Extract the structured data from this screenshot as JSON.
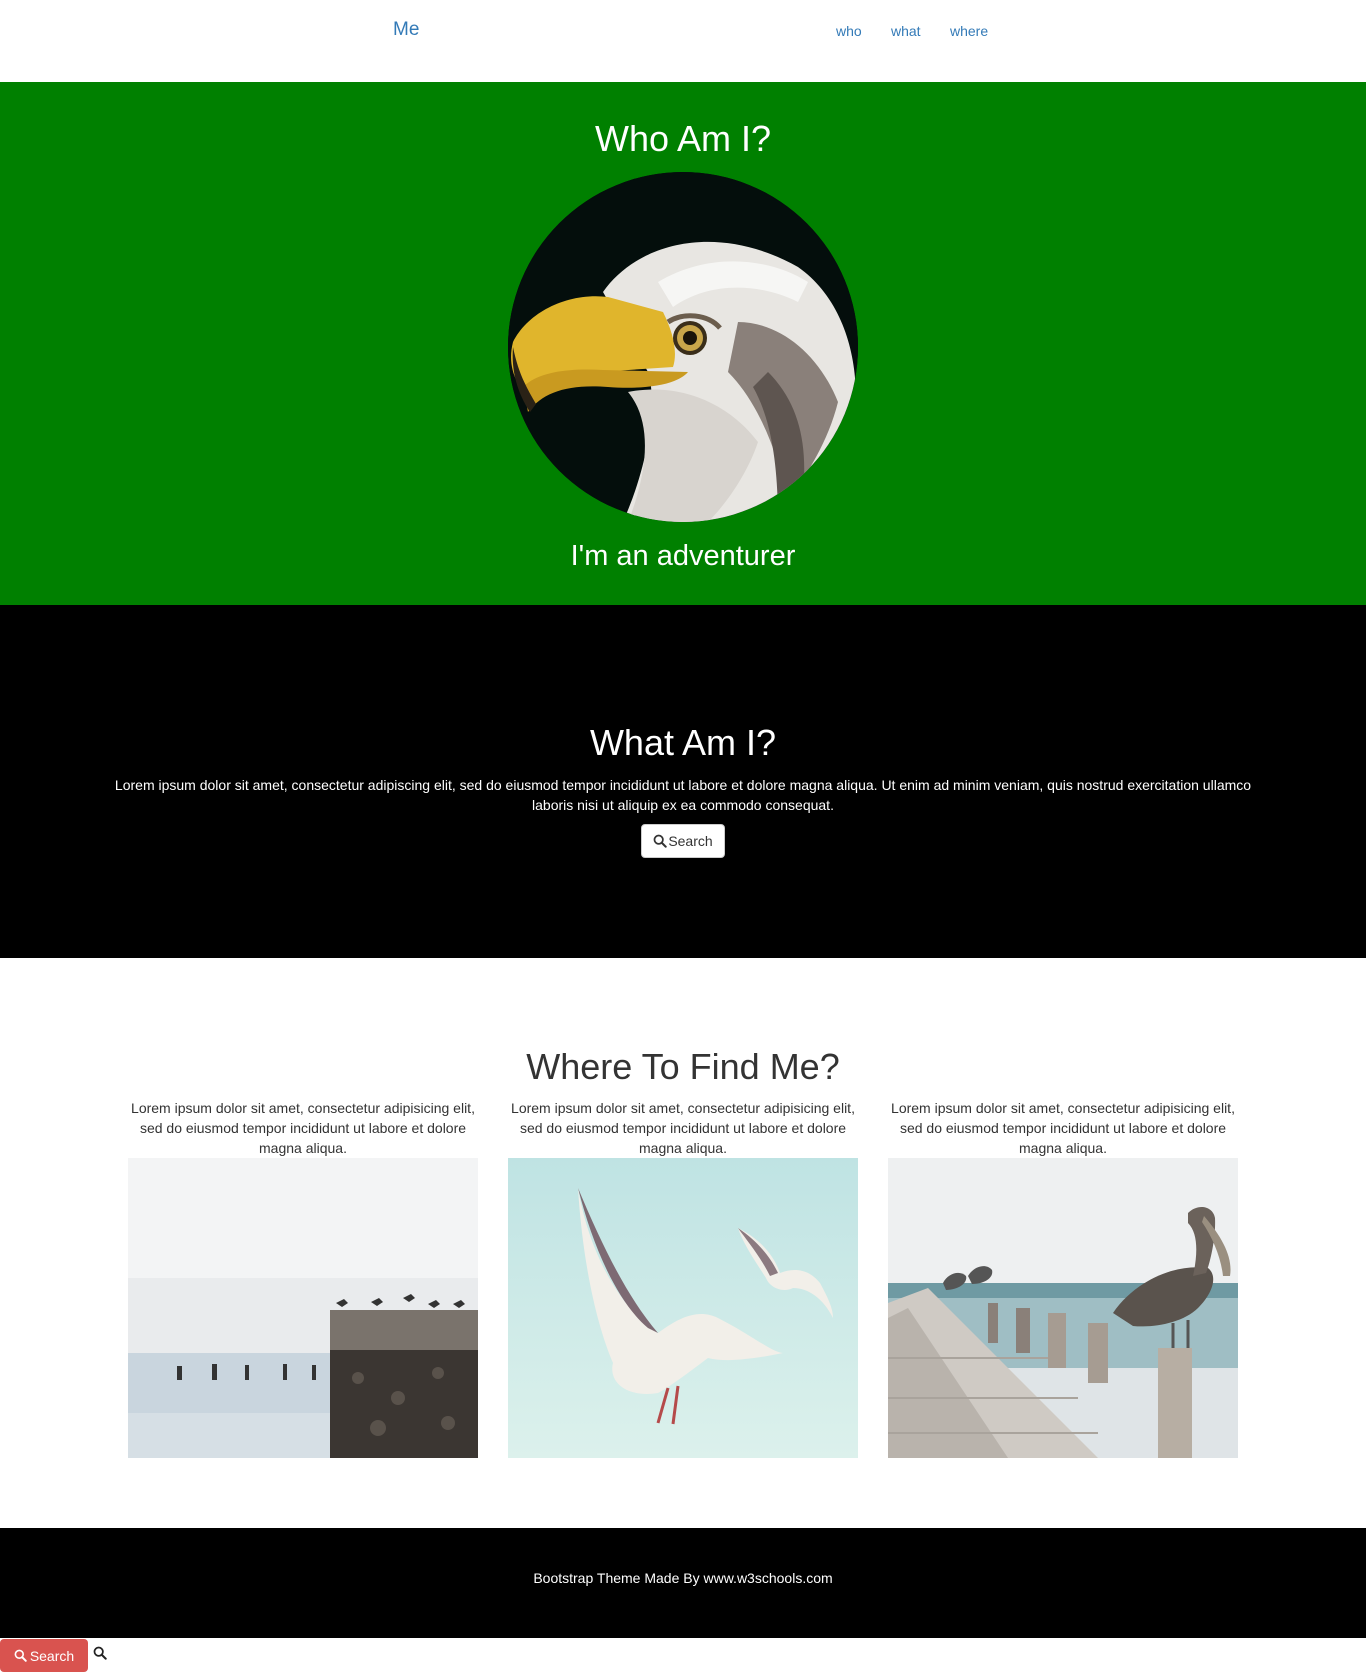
{
  "navbar": {
    "brand": "Me",
    "links": [
      "who",
      "what",
      "where"
    ],
    "link_color": "#337ab7"
  },
  "who": {
    "title": "Who Am I?",
    "tagline": "I'm an adventurer",
    "background": "#008000",
    "image": "eagle-portrait"
  },
  "what": {
    "title": "What Am I?",
    "description": "Lorem ipsum dolor sit amet, consectetur adipiscing elit, sed do eiusmod tempor incididunt ut labore et dolore magna aliqua. Ut enim ad minim veniam, quis nostrud exercitation ullamco laboris nisi ut aliquip ex ea commodo consequat.",
    "search_label": "Search",
    "search_icon": "search-icon",
    "background": "#000000"
  },
  "where": {
    "title": "Where To Find Me?",
    "columns": [
      {
        "text": "Lorem ipsum dolor sit amet, consectetur adipisicing elit, sed do eiusmod tempor incididunt ut labore et dolore magna aliqua.",
        "image": "birds-on-pier-post"
      },
      {
        "text": "Lorem ipsum dolor sit amet, consectetur adipisicing elit, sed do eiusmod tempor incididunt ut labore et dolore magna aliqua.",
        "image": "seagulls-flying"
      },
      {
        "text": "Lorem ipsum dolor sit amet, consectetur adipisicing elit, sed do eiusmod tempor incididunt ut labore et dolore magna aliqua.",
        "image": "pelicans-on-dock"
      }
    ]
  },
  "footer": {
    "prefix": "Bootstrap Theme Made By ",
    "link": "www.w3schools.com"
  },
  "bottombar": {
    "search_label": "Search",
    "button_color": "#d9534f"
  }
}
